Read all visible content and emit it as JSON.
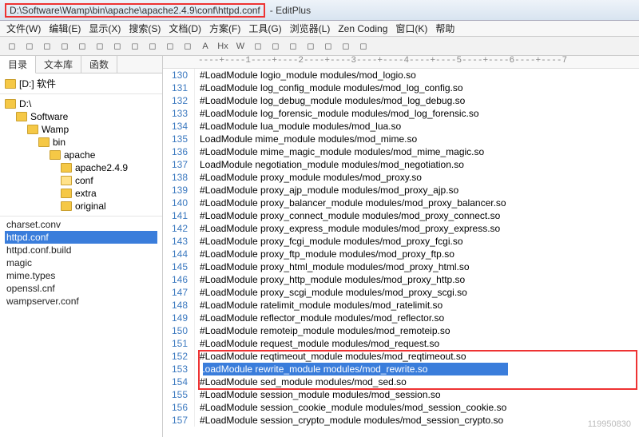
{
  "title_path": "D:\\Software\\Wamp\\bin\\apache\\apache2.4.9\\conf\\httpd.conf",
  "title_app": " - EditPlus",
  "menu": [
    "文件(W)",
    "编辑(E)",
    "显示(X)",
    "搜索(S)",
    "文档(D)",
    "方案(F)",
    "工具(G)",
    "浏览器(L)",
    "Zen Coding",
    "窗口(K)",
    "帮助"
  ],
  "side_tabs": [
    "目录",
    "文本库",
    "函数"
  ],
  "drive_label": "[D:] 软件",
  "tree": [
    {
      "depth": 0,
      "label": "D:\\"
    },
    {
      "depth": 1,
      "label": "Software"
    },
    {
      "depth": 2,
      "label": "Wamp"
    },
    {
      "depth": 3,
      "label": "bin"
    },
    {
      "depth": 4,
      "label": "apache"
    },
    {
      "depth": 5,
      "label": "apache2.4.9"
    },
    {
      "depth": 5,
      "label": "conf",
      "open": true
    },
    {
      "depth": 5,
      "label": "extra"
    },
    {
      "depth": 5,
      "label": "original"
    }
  ],
  "files": [
    {
      "name": "charset.conv",
      "sel": false
    },
    {
      "name": "httpd.conf",
      "sel": true
    },
    {
      "name": "httpd.conf.build",
      "sel": false
    },
    {
      "name": "magic",
      "sel": false
    },
    {
      "name": "mime.types",
      "sel": false
    },
    {
      "name": "openssl.cnf",
      "sel": false
    },
    {
      "name": "wampserver.conf",
      "sel": false
    }
  ],
  "ruler": "----+----1----+----2----+----3----+----4----+----5----+----6----+----7",
  "lines": [
    {
      "n": 130,
      "t": "#LoadModule logio_module modules/mod_logio.so"
    },
    {
      "n": 131,
      "t": "#LoadModule log_config_module modules/mod_log_config.so"
    },
    {
      "n": 132,
      "t": "#LoadModule log_debug_module modules/mod_log_debug.so"
    },
    {
      "n": 133,
      "t": "#LoadModule log_forensic_module modules/mod_log_forensic.so"
    },
    {
      "n": 134,
      "t": "#LoadModule lua_module modules/mod_lua.so"
    },
    {
      "n": 135,
      "t": "LoadModule mime_module modules/mod_mime.so"
    },
    {
      "n": 136,
      "t": "#LoadModule mime_magic_module modules/mod_mime_magic.so"
    },
    {
      "n": 137,
      "t": "LoadModule negotiation_module modules/mod_negotiation.so"
    },
    {
      "n": 138,
      "t": "#LoadModule proxy_module modules/mod_proxy.so"
    },
    {
      "n": 139,
      "t": "#LoadModule proxy_ajp_module modules/mod_proxy_ajp.so"
    },
    {
      "n": 140,
      "t": "#LoadModule proxy_balancer_module modules/mod_proxy_balancer.so"
    },
    {
      "n": 141,
      "t": "#LoadModule proxy_connect_module modules/mod_proxy_connect.so"
    },
    {
      "n": 142,
      "t": "#LoadModule proxy_express_module modules/mod_proxy_express.so"
    },
    {
      "n": 143,
      "t": "#LoadModule proxy_fcgi_module modules/mod_proxy_fcgi.so"
    },
    {
      "n": 144,
      "t": "#LoadModule proxy_ftp_module modules/mod_proxy_ftp.so"
    },
    {
      "n": 145,
      "t": "#LoadModule proxy_html_module modules/mod_proxy_html.so"
    },
    {
      "n": 146,
      "t": "#LoadModule proxy_http_module modules/mod_proxy_http.so"
    },
    {
      "n": 147,
      "t": "#LoadModule proxy_scgi_module modules/mod_proxy_scgi.so"
    },
    {
      "n": 148,
      "t": "#LoadModule ratelimit_module modules/mod_ratelimit.so"
    },
    {
      "n": 149,
      "t": "#LoadModule reflector_module modules/mod_reflector.so"
    },
    {
      "n": 150,
      "t": "#LoadModule remoteip_module modules/mod_remoteip.so"
    },
    {
      "n": 151,
      "t": "#LoadModule request_module modules/mod_request.so"
    },
    {
      "n": 152,
      "t": "#LoadModule reqtimeout_module modules/mod_reqtimeout.so"
    },
    {
      "n": 153,
      "t": "LoadModule rewrite_module modules/mod_rewrite.so",
      "sel": true
    },
    {
      "n": 154,
      "t": "#LoadModule sed_module modules/mod_sed.so"
    },
    {
      "n": 155,
      "t": "#LoadModule session_module modules/mod_session.so"
    },
    {
      "n": 156,
      "t": "#LoadModule session_cookie_module modules/mod_session_cookie.so"
    },
    {
      "n": 157,
      "t": "#LoadModule session_crypto_module modules/mod_session_crypto.so"
    }
  ],
  "watermark": "119950830",
  "toolbar_icons": [
    "new",
    "open",
    "save",
    "print",
    "cut",
    "copy",
    "paste",
    "undo",
    "redo",
    "find",
    "replace",
    "A",
    "Hx",
    "W",
    "spell",
    "indent",
    "outdent",
    "bookmark",
    "comment",
    "wrap",
    "zoom"
  ]
}
